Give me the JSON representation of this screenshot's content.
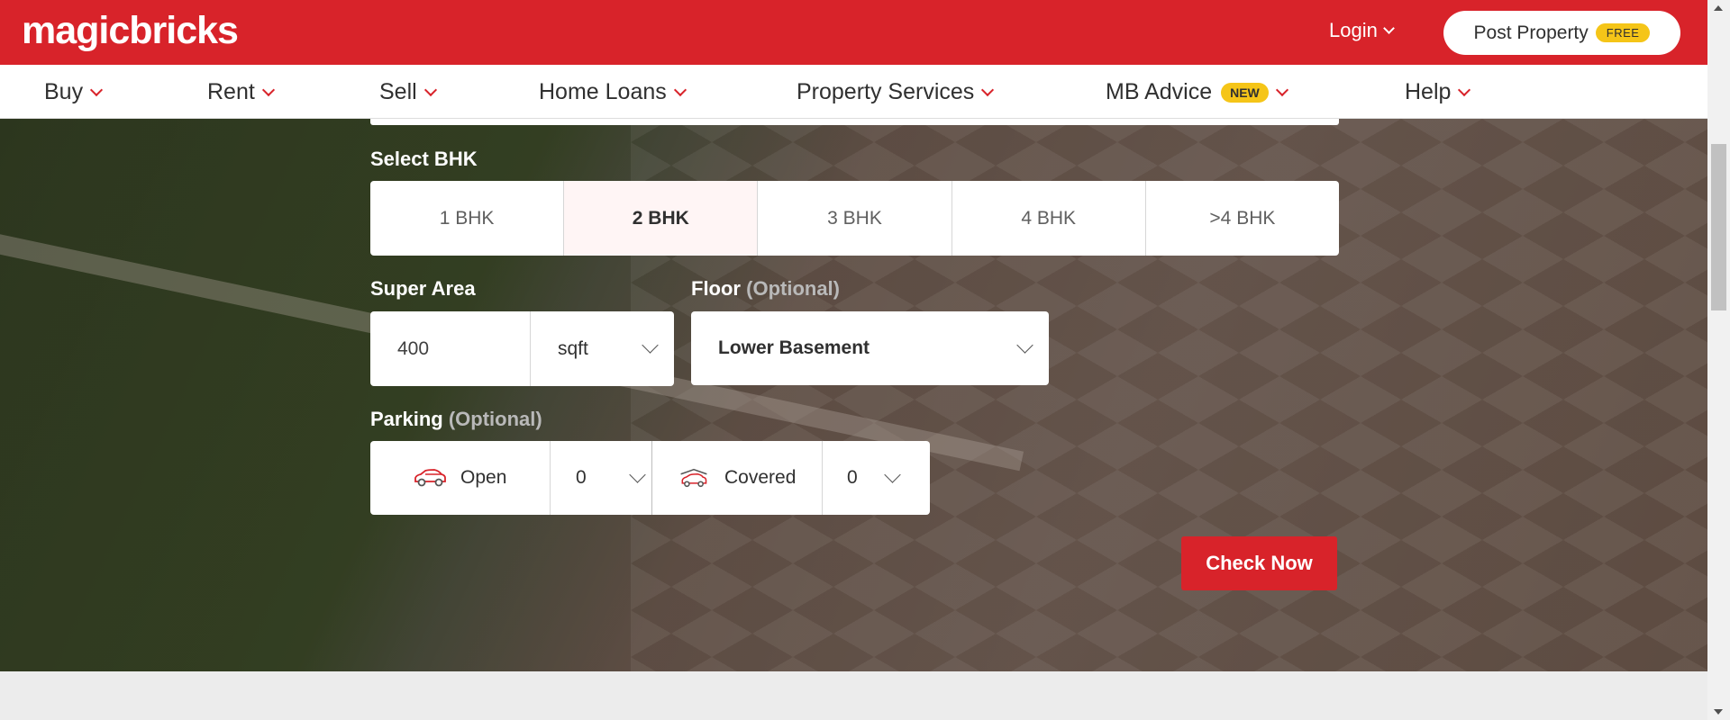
{
  "header": {
    "logo_text": "magicbricks",
    "login_label": "Login",
    "post_property_label": "Post Property",
    "free_badge": "FREE"
  },
  "nav": {
    "items": [
      {
        "label": "Buy"
      },
      {
        "label": "Rent"
      },
      {
        "label": "Sell"
      },
      {
        "label": "Home Loans"
      },
      {
        "label": "Property Services"
      },
      {
        "label": "MB Advice",
        "badge": "NEW"
      },
      {
        "label": "Help"
      }
    ]
  },
  "form": {
    "bhk_label": "Select BHK",
    "bhk_options": [
      "1 BHK",
      "2 BHK",
      "3 BHK",
      "4 BHK",
      ">4 BHK"
    ],
    "bhk_selected": "2 BHK",
    "super_area_label": "Super Area",
    "super_area_value": "400",
    "super_area_unit": "sqft",
    "floor_label": "Floor",
    "optional_text": "(Optional)",
    "floor_value": "Lower Basement",
    "parking_label": "Parking",
    "parking_open_label": "Open",
    "parking_open_value": "0",
    "parking_covered_label": "Covered",
    "parking_covered_value": "0",
    "check_button": "Check Now"
  },
  "colors": {
    "brand_red": "#d8232a",
    "badge_yellow": "#f5c518"
  }
}
